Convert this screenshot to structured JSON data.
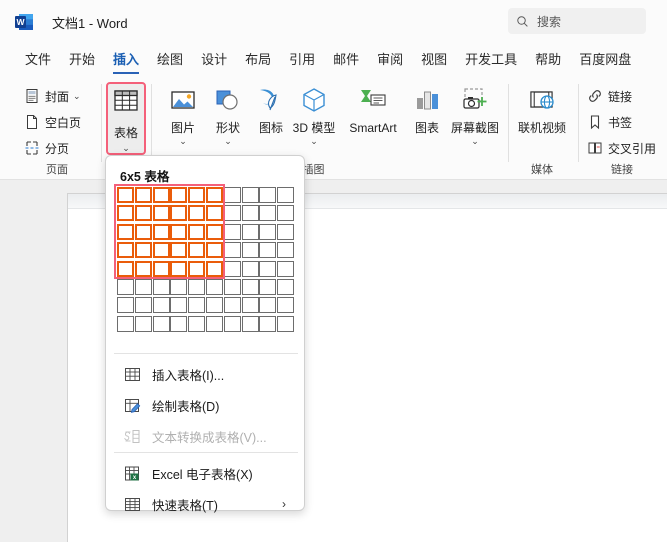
{
  "titlebar": {
    "logo_icon": "word-logo-icon",
    "document_title": "文档1  -  Word",
    "search": {
      "icon": "search-icon",
      "placeholder": "搜索"
    }
  },
  "ribbon": {
    "tabs": [
      {
        "label": "文件",
        "active": false
      },
      {
        "label": "开始",
        "active": false
      },
      {
        "label": "插入",
        "active": true
      },
      {
        "label": "绘图",
        "active": false
      },
      {
        "label": "设计",
        "active": false
      },
      {
        "label": "布局",
        "active": false
      },
      {
        "label": "引用",
        "active": false
      },
      {
        "label": "邮件",
        "active": false
      },
      {
        "label": "审阅",
        "active": false
      },
      {
        "label": "视图",
        "active": false
      },
      {
        "label": "开发工具",
        "active": false
      },
      {
        "label": "帮助",
        "active": false
      },
      {
        "label": "百度网盘",
        "active": false
      }
    ],
    "groups": [
      {
        "name": "页面",
        "items": [
          {
            "label": "封面",
            "icon": "cover-page-icon",
            "caret": "⌄"
          },
          {
            "label": "空白页",
            "icon": "blank-page-icon",
            "caret": ""
          },
          {
            "label": "分页",
            "icon": "page-break-icon",
            "caret": ""
          }
        ]
      },
      {
        "name": "表格",
        "items": [
          {
            "label": "表格",
            "icon": "table-icon",
            "caret": "⌄"
          }
        ]
      },
      {
        "name": "插图",
        "items": [
          {
            "label": "图片",
            "icon": "picture-icon",
            "caret": "⌄"
          },
          {
            "label": "形状",
            "icon": "shapes-icon",
            "caret": "⌄"
          },
          {
            "label": "图标",
            "icon": "icons-icon",
            "caret": ""
          },
          {
            "label": "3D 模型",
            "icon": "3d-model-icon",
            "caret": "⌄"
          },
          {
            "label": "SmartArt",
            "icon": "smartart-icon",
            "caret": ""
          },
          {
            "label": "图表",
            "icon": "chart-icon",
            "caret": ""
          },
          {
            "label": "屏幕截图",
            "icon": "screenshot-icon",
            "caret": "⌄"
          }
        ]
      },
      {
        "name": "媒体",
        "items": [
          {
            "label": "联机视频",
            "icon": "online-video-icon",
            "caret": ""
          }
        ]
      },
      {
        "name": "链接",
        "items": [
          {
            "label": "链接",
            "icon": "link-icon",
            "caret": ""
          },
          {
            "label": "书签",
            "icon": "bookmark-icon",
            "caret": ""
          },
          {
            "label": "交叉引用",
            "icon": "cross-reference-icon",
            "caret": ""
          }
        ]
      }
    ]
  },
  "table_dropdown": {
    "title": "6x5 表格",
    "grid": {
      "columns": 10,
      "rows": 8,
      "selected_columns": 6,
      "selected_rows": 5,
      "cell_color": "#ea5c0a",
      "selection_outline_color": "#f4607a"
    },
    "menu_items": [
      {
        "label": "插入表格(I)...",
        "icon": "insert-table-icon",
        "disabled": false,
        "submenu": false
      },
      {
        "label": "绘制表格(D)",
        "icon": "draw-table-icon",
        "disabled": false,
        "submenu": false
      },
      {
        "label": "文本转换成表格(V)...",
        "icon": "text-to-table-icon",
        "disabled": true,
        "submenu": false
      },
      {
        "label": "Excel 电子表格(X)",
        "icon": "excel-spreadsheet-icon",
        "disabled": false,
        "submenu": false
      },
      {
        "label": "快速表格(T)",
        "icon": "quick-tables-icon",
        "disabled": false,
        "submenu": true
      }
    ],
    "submenu_arrow": "›"
  },
  "colors": {
    "accent": "#2a62b6",
    "highlight": "#f4607a",
    "table_orange": "#ea5c0a",
    "excel_green": "#217346"
  }
}
